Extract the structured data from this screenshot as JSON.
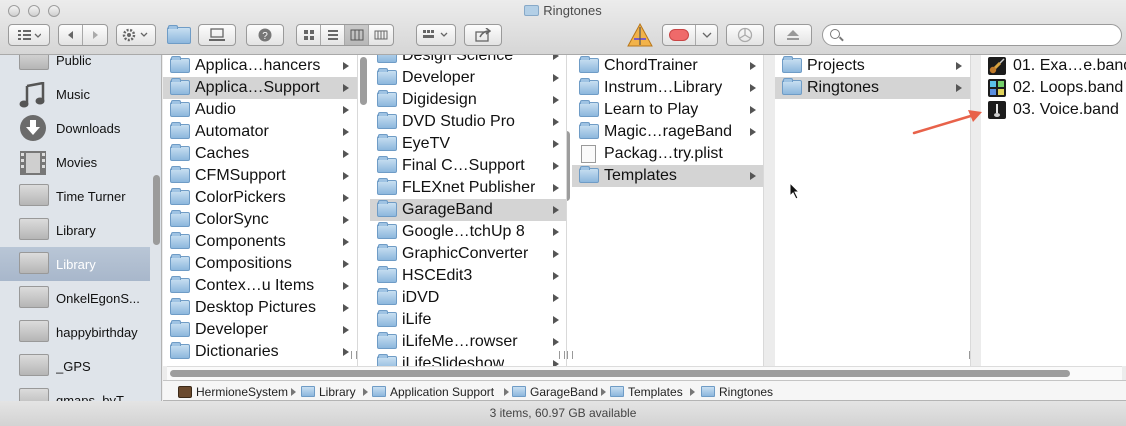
{
  "window": {
    "title": "Ringtones"
  },
  "toolbar": {
    "icons": [
      "sidebar-toggle-icon",
      "back-icon",
      "forward-icon",
      "gear-icon",
      "new-folder-icon",
      "connect-icon",
      "help-icon",
      "icon-view-icon",
      "list-view-icon",
      "column-view-icon",
      "coverflow-view-icon",
      "arrange-icon",
      "share-icon",
      "instruments-icon",
      "tag-icon",
      "burn-icon",
      "eject-icon"
    ],
    "search": {
      "placeholder": "",
      "value": ""
    }
  },
  "sidebar": {
    "items": [
      {
        "label": "Public",
        "icon": "folder-icon"
      },
      {
        "label": "Music",
        "icon": "music-icon"
      },
      {
        "label": "Downloads",
        "icon": "downloads-icon"
      },
      {
        "label": "Movies",
        "icon": "movies-icon"
      },
      {
        "label": "Time Turner",
        "icon": "folder-icon"
      },
      {
        "label": "Library",
        "icon": "folder-icon"
      },
      {
        "label": "Library",
        "icon": "folder-icon",
        "selected": true
      },
      {
        "label": "OnkelEgonS...",
        "icon": "folder-icon"
      },
      {
        "label": "happybirthday",
        "icon": "folder-icon"
      },
      {
        "label": "_GPS",
        "icon": "folder-icon"
      },
      {
        "label": "gmaps_byT...",
        "icon": "folder-icon"
      }
    ]
  },
  "columns": [
    {
      "items": [
        {
          "label": "Applica…hancers",
          "arrow": true
        },
        {
          "label": "Applica…Support",
          "arrow": true,
          "selected": true
        },
        {
          "label": "Audio",
          "arrow": true
        },
        {
          "label": "Automator",
          "arrow": true
        },
        {
          "label": "Caches",
          "arrow": true
        },
        {
          "label": "CFMSupport",
          "arrow": true
        },
        {
          "label": "ColorPickers",
          "arrow": true
        },
        {
          "label": "ColorSync",
          "arrow": true
        },
        {
          "label": "Components",
          "arrow": true
        },
        {
          "label": "Compositions",
          "arrow": true
        },
        {
          "label": "Contex…u Items",
          "arrow": true
        },
        {
          "label": "Desktop Pictures",
          "arrow": true
        },
        {
          "label": "Developer",
          "arrow": true
        },
        {
          "label": "Dictionaries",
          "arrow": true
        }
      ]
    },
    {
      "items": [
        {
          "label": "Design Science",
          "arrow": true
        },
        {
          "label": "Developer",
          "arrow": true
        },
        {
          "label": "Digidesign",
          "arrow": true
        },
        {
          "label": "DVD Studio Pro",
          "arrow": true
        },
        {
          "label": "EyeTV",
          "arrow": true
        },
        {
          "label": "Final C…Support",
          "arrow": true
        },
        {
          "label": "FLEXnet Publisher",
          "arrow": true
        },
        {
          "label": "GarageBand",
          "arrow": true,
          "selected": true
        },
        {
          "label": "Google…tchUp 8",
          "arrow": true
        },
        {
          "label": "GraphicConverter",
          "arrow": true
        },
        {
          "label": "HSCEdit3",
          "arrow": true
        },
        {
          "label": "iDVD",
          "arrow": true
        },
        {
          "label": "iLife",
          "arrow": true
        },
        {
          "label": "iLifeMe…rowser",
          "arrow": true
        },
        {
          "label": "iLifeSlideshow",
          "arrow": true
        }
      ]
    },
    {
      "items": [
        {
          "label": "ChordTrainer",
          "arrow": true
        },
        {
          "label": "Instrum…Library",
          "arrow": true
        },
        {
          "label": "Learn to Play",
          "arrow": true
        },
        {
          "label": "Magic…rageBand",
          "arrow": true
        },
        {
          "label": "Packag…try.plist",
          "arrow": false,
          "kind": "document"
        },
        {
          "label": "Templates",
          "arrow": true,
          "selected": true
        }
      ]
    },
    {
      "items": [
        {
          "label": "Projects",
          "arrow": true
        },
        {
          "label": "Ringtones",
          "arrow": true,
          "selected": true
        }
      ]
    },
    {
      "items": [
        {
          "label": "01. Exa…e.band",
          "arrow": false,
          "kind": "band-guitar"
        },
        {
          "label": "02. Loops.band",
          "arrow": false,
          "kind": "band-loops"
        },
        {
          "label": "03. Voice.band",
          "arrow": false,
          "kind": "band-voice"
        }
      ]
    }
  ],
  "pathbar": {
    "items": [
      {
        "label": "HermioneSystem",
        "icon": "hard-drive-icon"
      },
      {
        "label": "Library",
        "icon": "folder-icon"
      },
      {
        "label": "Application Support",
        "icon": "folder-icon"
      },
      {
        "label": "GarageBand",
        "icon": "folder-icon"
      },
      {
        "label": "Templates",
        "icon": "folder-icon"
      },
      {
        "label": "Ringtones",
        "icon": "folder-icon"
      }
    ]
  },
  "status": {
    "text": "3 items, 60.97 GB available"
  },
  "colors": {
    "selection": "#d4d4d4",
    "sidebar_selection": "#a8b7cb",
    "annotation_arrow": "#e8624a",
    "tag_red": "#ef6a6a"
  }
}
